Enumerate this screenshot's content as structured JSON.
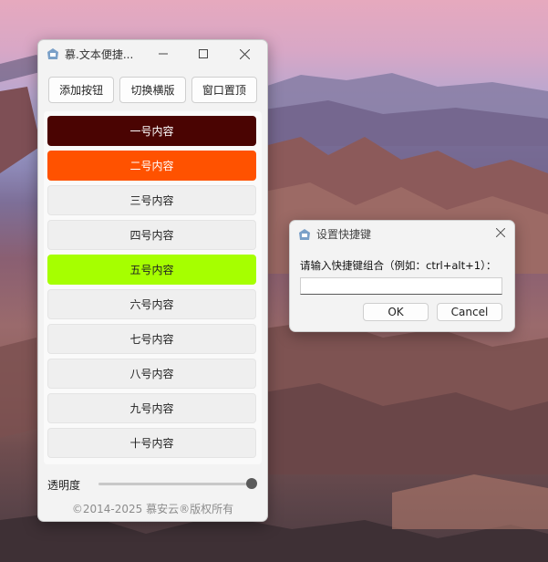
{
  "main_window": {
    "title": "慕.文本便捷...",
    "minimize_icon": "minimize-icon",
    "maximize_icon": "maximize-icon",
    "close_icon": "close-icon",
    "toolbar": {
      "add_button": "添加按钮",
      "switch_layout_button": "切换横版",
      "pin_top_button": "窗口置顶"
    },
    "items": [
      {
        "label": "一号内容",
        "color": "#4a0402"
      },
      {
        "label": "二号内容",
        "color": "#ff5200"
      },
      {
        "label": "三号内容",
        "color": "#efefef"
      },
      {
        "label": "四号内容",
        "color": "#efefef"
      },
      {
        "label": "五号内容",
        "color": "#a6ff00"
      },
      {
        "label": "六号内容",
        "color": "#efefef"
      },
      {
        "label": "七号内容",
        "color": "#efefef"
      },
      {
        "label": "八号内容",
        "color": "#efefef"
      },
      {
        "label": "九号内容",
        "color": "#efefef"
      },
      {
        "label": "十号内容",
        "color": "#efefef"
      }
    ],
    "opacity_label": "透明度",
    "opacity_value": 1.0,
    "footer": "©2014-2025 慕安云®版权所有"
  },
  "dialog": {
    "title": "设置快捷键",
    "prompt": "请输入快捷键组合（例如：ctrl+alt+1）：",
    "input_value": "",
    "ok_button": "OK",
    "cancel_button": "Cancel"
  }
}
